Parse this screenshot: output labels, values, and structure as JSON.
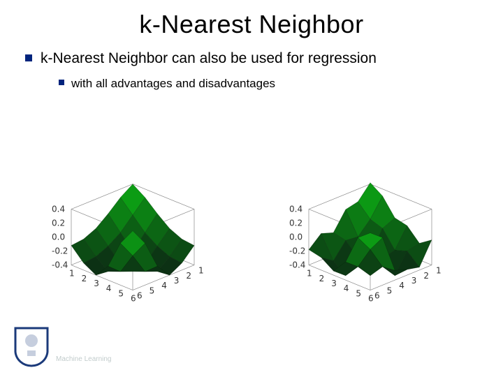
{
  "title": "k-Nearest Neighbor",
  "bullets": {
    "level1": "k-Nearest Neighbor can also be used for regression",
    "level2": "with all advantages and disadvantages"
  },
  "footer": "Machine Learning",
  "logo_name": "university-crest-icon",
  "accent_color": "#00247d",
  "surface_color": "#1a6b1a",
  "chart_data": [
    {
      "type": "surface3d",
      "title": "",
      "function": "smooth-regression-surface",
      "x_range": [
        1,
        6
      ],
      "y_range": [
        1,
        6
      ],
      "z_ticks": [
        -0.4,
        -0.2,
        0.0,
        0.2,
        0.4
      ],
      "x_ticks": [
        1,
        2,
        3,
        4,
        5,
        6
      ],
      "y_ticks": [
        1,
        2,
        3,
        4,
        5,
        6
      ],
      "approx_z": [
        [
          0.4,
          0.28,
          0.12,
          -0.02,
          -0.1,
          -0.12
        ],
        [
          0.28,
          0.1,
          -0.08,
          -0.2,
          -0.28,
          -0.3
        ],
        [
          0.12,
          -0.08,
          -0.28,
          -0.38,
          -0.42,
          -0.4
        ],
        [
          -0.02,
          -0.2,
          -0.38,
          -0.42,
          -0.35,
          -0.2
        ],
        [
          -0.1,
          -0.28,
          -0.42,
          -0.35,
          -0.05,
          0.2
        ],
        [
          -0.12,
          -0.3,
          -0.4,
          -0.2,
          0.2,
          0.45
        ]
      ]
    },
    {
      "type": "surface3d",
      "title": "",
      "function": "knn-regression-surface (noisy)",
      "x_range": [
        1,
        6
      ],
      "y_range": [
        1,
        6
      ],
      "z_ticks": [
        -0.4,
        -0.2,
        0.0,
        0.2,
        0.4
      ],
      "x_ticks": [
        1,
        2,
        3,
        4,
        5,
        6
      ],
      "y_ticks": [
        1,
        2,
        3,
        4,
        5,
        6
      ],
      "approx_z": [
        [
          0.42,
          0.22,
          0.18,
          -0.08,
          -0.02,
          -0.18
        ],
        [
          0.3,
          0.04,
          -0.14,
          -0.12,
          -0.34,
          -0.22
        ],
        [
          0.06,
          -0.02,
          -0.34,
          -0.3,
          -0.48,
          -0.34
        ],
        [
          0.02,
          -0.26,
          -0.3,
          -0.48,
          -0.28,
          -0.14
        ],
        [
          -0.16,
          -0.2,
          -0.48,
          -0.28,
          0.04,
          0.28
        ],
        [
          -0.04,
          -0.36,
          -0.32,
          -0.26,
          0.28,
          0.42
        ]
      ]
    }
  ]
}
